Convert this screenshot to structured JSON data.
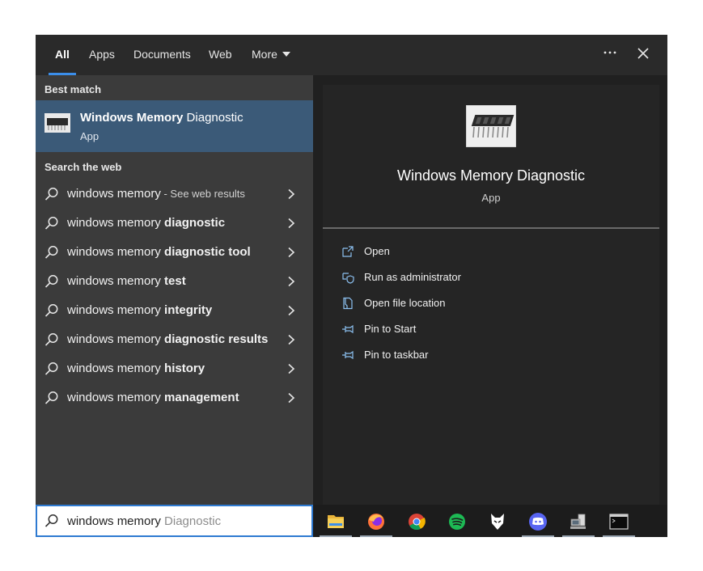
{
  "tabs": [
    {
      "label": "All",
      "active": true
    },
    {
      "label": "Apps"
    },
    {
      "label": "Documents"
    },
    {
      "label": "Web"
    },
    {
      "label": "More"
    }
  ],
  "menu_icon": "ellipsis-icon",
  "close_icon": "close-icon",
  "best_match": {
    "section_label": "Best match",
    "title_bold": "Windows Memory",
    "title_rest": " Diagnostic",
    "subtitle": "App",
    "icon": "memory-chip-icon"
  },
  "web": {
    "section_label": "Search the web",
    "items": [
      {
        "prefix": "windows memory",
        "bold": "",
        "suffix": " - See web results"
      },
      {
        "prefix": "windows memory ",
        "bold": "diagnostic",
        "suffix": ""
      },
      {
        "prefix": "windows memory ",
        "bold": "diagnostic tool",
        "suffix": ""
      },
      {
        "prefix": "windows memory ",
        "bold": "test",
        "suffix": ""
      },
      {
        "prefix": "windows memory ",
        "bold": "integrity",
        "suffix": ""
      },
      {
        "prefix": "windows memory ",
        "bold": "diagnostic results",
        "suffix": ""
      },
      {
        "prefix": "windows memory ",
        "bold": "history",
        "suffix": ""
      },
      {
        "prefix": "windows memory ",
        "bold": "management",
        "suffix": ""
      }
    ]
  },
  "preview": {
    "title": "Windows Memory Diagnostic",
    "subtitle": "App",
    "actions": [
      {
        "label": "Open",
        "icon": "open-icon"
      },
      {
        "label": "Run as administrator",
        "icon": "shield-icon"
      },
      {
        "label": "Open file location",
        "icon": "file-location-icon"
      },
      {
        "label": "Pin to Start",
        "icon": "pin-icon"
      },
      {
        "label": "Pin to taskbar",
        "icon": "pin-icon"
      }
    ]
  },
  "search": {
    "typed": "windows memory ",
    "suggestion": "Diagnostic"
  },
  "taskbar": [
    {
      "name": "file-explorer-icon",
      "active": true
    },
    {
      "name": "firefox-icon",
      "active": true
    },
    {
      "name": "chrome-icon",
      "active": false
    },
    {
      "name": "spotify-icon",
      "active": false
    },
    {
      "name": "foobar-icon",
      "active": false
    },
    {
      "name": "discord-icon",
      "active": true
    },
    {
      "name": "network-computer-icon",
      "active": true
    },
    {
      "name": "terminal-icon",
      "active": true
    }
  ],
  "colors": {
    "accent": "#3b8eea",
    "best_match_bg": "#3b5a78",
    "search_border": "#2e7ad1"
  }
}
